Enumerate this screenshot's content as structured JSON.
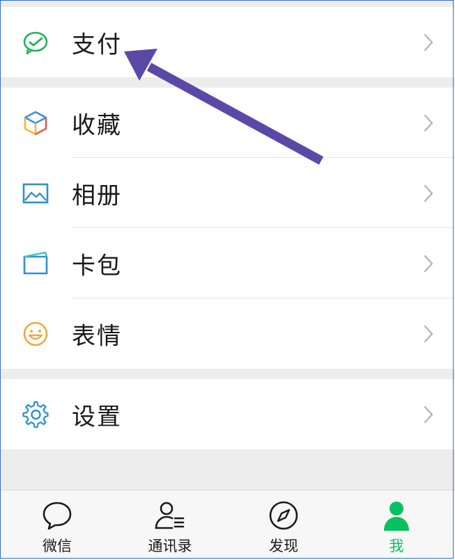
{
  "menu": {
    "pay": {
      "label": "支付",
      "icon": "wechat-pay-icon"
    },
    "favorites": {
      "label": "收藏",
      "icon": "cube-icon"
    },
    "album": {
      "label": "相册",
      "icon": "picture-icon"
    },
    "cards": {
      "label": "卡包",
      "icon": "card-wallet-icon"
    },
    "stickers": {
      "label": "表情",
      "icon": "smiley-icon"
    },
    "settings": {
      "label": "设置",
      "icon": "gear-icon"
    }
  },
  "tabbar": {
    "chats": {
      "label": "微信",
      "icon": "chat-bubble-icon"
    },
    "contacts": {
      "label": "通讯录",
      "icon": "contacts-icon"
    },
    "discover": {
      "label": "发现",
      "icon": "compass-icon"
    },
    "me": {
      "label": "我",
      "icon": "person-icon",
      "active": true
    }
  },
  "colors": {
    "accent_green": "#07c160",
    "annotation_arrow": "#5b49a8",
    "frame_border": "#2f6fd6"
  }
}
